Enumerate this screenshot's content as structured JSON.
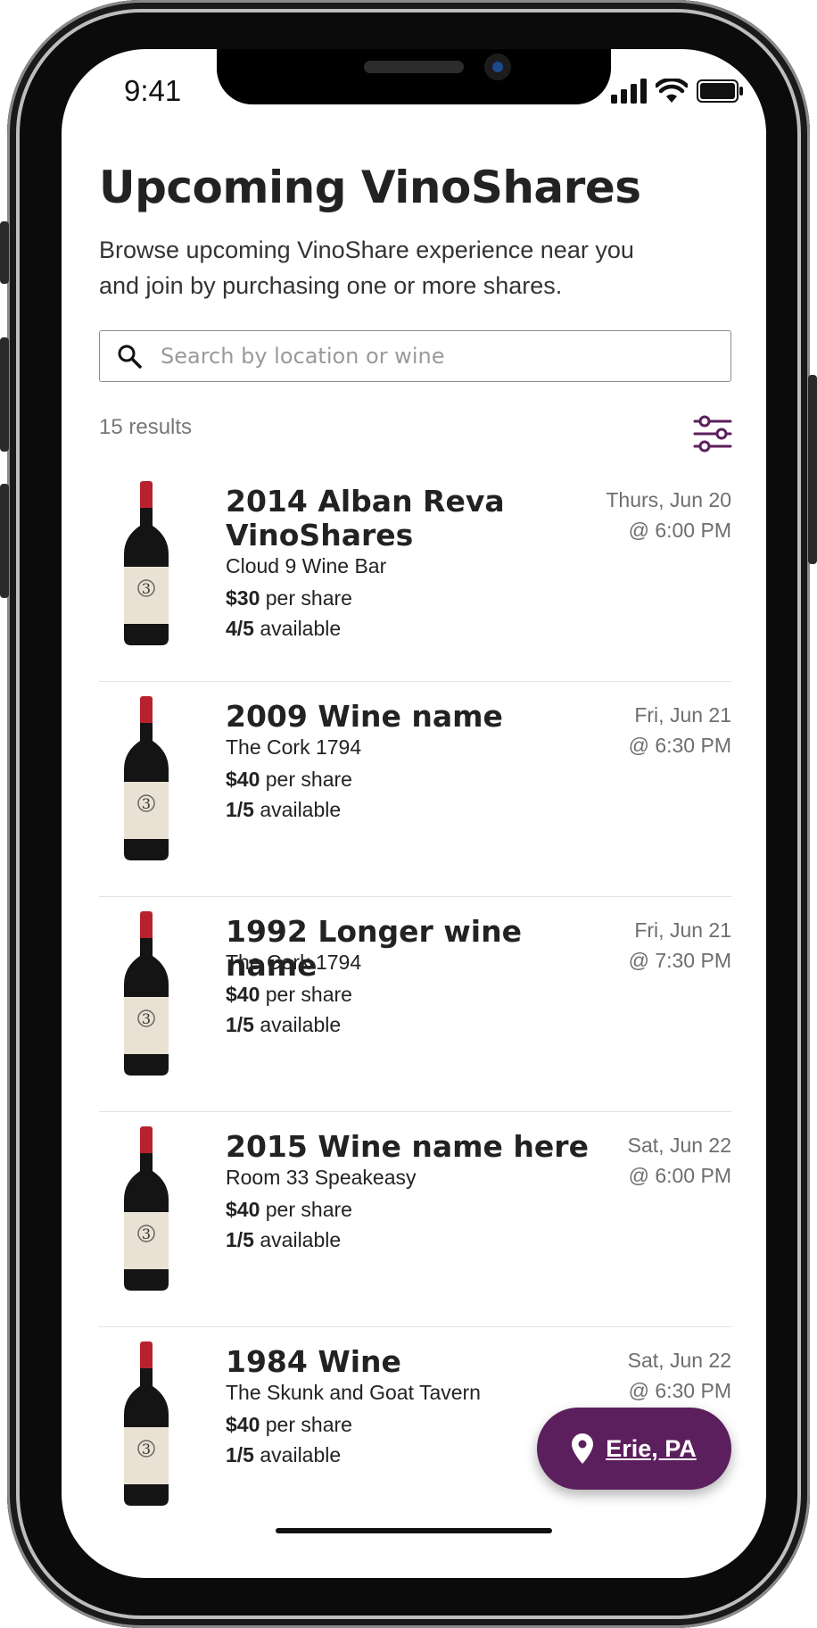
{
  "status_bar": {
    "time": "9:41"
  },
  "header": {
    "title": "Upcoming VinoShares",
    "subtitle": "Browse upcoming VinoShare experience near you and join by purchasing one or more shares."
  },
  "search": {
    "placeholder": "Search by location or wine",
    "value": ""
  },
  "results": {
    "count_text": "15 results"
  },
  "items": [
    {
      "name": "2014 Alban Reva VinoShares",
      "venue": "Cloud 9 Wine Bar",
      "price": "$30",
      "price_suffix": "per share",
      "available": "4/5",
      "available_suffix": "available",
      "date": "Thurs, Jun 20",
      "time": "@ 6:00 PM"
    },
    {
      "name": "2009 Wine name",
      "venue": "The Cork 1794",
      "price": "$40",
      "price_suffix": "per share",
      "available": "1/5",
      "available_suffix": "available",
      "date": "Fri, Jun 21",
      "time": "@ 6:30 PM"
    },
    {
      "name": "1992 Longer wine name",
      "venue": "The Cork 1794",
      "price": "$40",
      "price_suffix": "per share",
      "available": "1/5",
      "available_suffix": "available",
      "date": "Fri, Jun 21",
      "time": "@ 7:30 PM"
    },
    {
      "name": "2015 Wine name here",
      "venue": "Room 33 Speakeasy",
      "price": "$40",
      "price_suffix": "per share",
      "available": "1/5",
      "available_suffix": "available",
      "date": "Sat, Jun 22",
      "time": "@ 6:00 PM"
    },
    {
      "name": "1984 Wine",
      "venue": "The Skunk and Goat Tavern",
      "price": "$40",
      "price_suffix": "per share",
      "available": "1/5",
      "available_suffix": "available",
      "date": "Sat, Jun 22",
      "time": "@ 6:30 PM"
    }
  ],
  "location_button": {
    "label": "Erie, PA",
    "icon": "location-pin-icon"
  },
  "colors": {
    "brand": "#5c1f5d",
    "text": "#222222",
    "muted": "#6e6e6e",
    "divider": "#e2e2e2"
  }
}
